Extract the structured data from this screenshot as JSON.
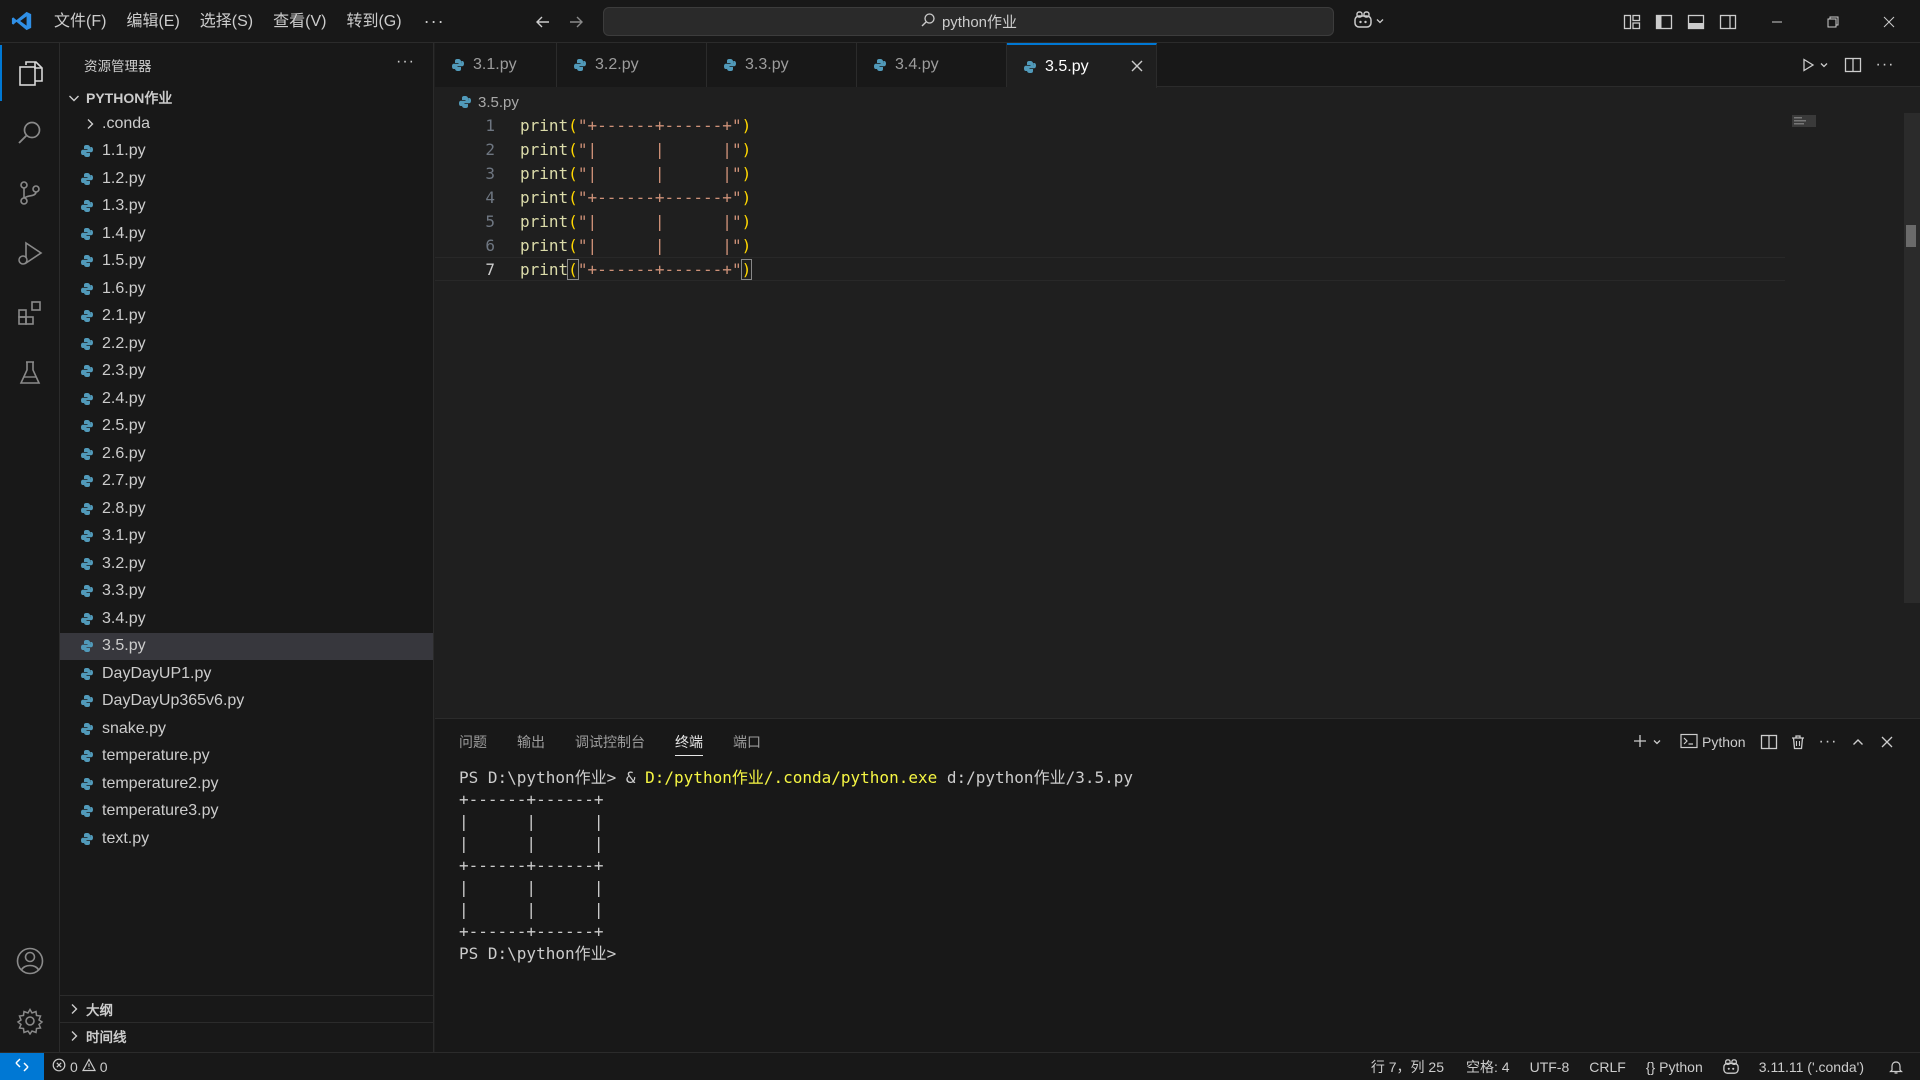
{
  "titlebar": {
    "menu": [
      "文件(F)",
      "编辑(E)",
      "选择(S)",
      "查看(V)",
      "转到(G)"
    ],
    "menu_more": "···",
    "search_text": "python作业"
  },
  "sidebar": {
    "header": "资源管理器",
    "more": "···",
    "folder_name": "PYTHON作业",
    "folders": [
      ".conda"
    ],
    "files": [
      "1.1.py",
      "1.2.py",
      "1.3.py",
      "1.4.py",
      "1.5.py",
      "1.6.py",
      "2.1.py",
      "2.2.py",
      "2.3.py",
      "2.4.py",
      "2.5.py",
      "2.6.py",
      "2.7.py",
      "2.8.py",
      "3.1.py",
      "3.2.py",
      "3.3.py",
      "3.4.py",
      "3.5.py",
      "DayDayUP1.py",
      "DayDayUp365v6.py",
      "snake.py",
      "temperature.py",
      "temperature2.py",
      "temperature3.py",
      "text.py"
    ],
    "selected_file": "3.5.py",
    "outline_label": "大纲",
    "timeline_label": "时间线"
  },
  "tabs": [
    {
      "label": "3.1.py",
      "active": false
    },
    {
      "label": "3.2.py",
      "active": false
    },
    {
      "label": "3.3.py",
      "active": false
    },
    {
      "label": "3.4.py",
      "active": false
    },
    {
      "label": "3.5.py",
      "active": true
    }
  ],
  "breadcrumb": "3.5.py",
  "editor": {
    "lines": [
      {
        "n": "1",
        "text": "\"+------+------+\""
      },
      {
        "n": "2",
        "text": "\"|      |      |\""
      },
      {
        "n": "3",
        "text": "\"|      |      |\""
      },
      {
        "n": "4",
        "text": "\"+------+------+\""
      },
      {
        "n": "5",
        "text": "\"|      |      |\""
      },
      {
        "n": "6",
        "text": "\"|      |      |\""
      },
      {
        "n": "7",
        "text": "\"+------+------+\""
      }
    ],
    "fn_name": "print",
    "current_line": "7"
  },
  "panel": {
    "tabs": [
      "问题",
      "输出",
      "调试控制台",
      "终端",
      "端口"
    ],
    "active_tab": "终端",
    "terminal_profile": "Python",
    "terminal": {
      "prompt": "PS D:\\python作业> ",
      "cmd_amp": "& ",
      "cmd_exe": "D:/python作业/.conda/python.exe",
      "cmd_arg": " d:/python作业/3.5.py",
      "output": [
        "+------+------+",
        "|      |      |",
        "|      |      |",
        "+------+------+",
        "|      |      |",
        "|      |      |",
        "+------+------+"
      ],
      "final_prompt": "PS D:\\python作业>"
    }
  },
  "statusbar": {
    "errors": "0",
    "warnings": "0",
    "position": "行 7，列 25",
    "spaces": "空格: 4",
    "encoding": "UTF-8",
    "eol": "CRLF",
    "language": "Python",
    "language_prefix": "{}",
    "interpreter": "3.11.11 ('.conda')"
  },
  "colors": {
    "accent": "#0078d4",
    "python_icon": "#519aba",
    "function": "#dcdcaa",
    "string": "#ce9178",
    "bracket": "#ffd700",
    "terminal_highlight": "#f5f543"
  }
}
